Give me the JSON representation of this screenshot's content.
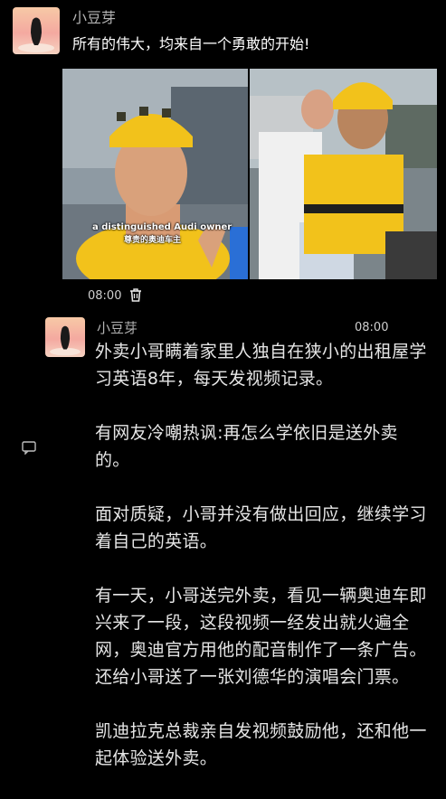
{
  "post1": {
    "username": "小豆芽",
    "caption": "所有的伟大，均来自一个勇敢的开始!",
    "video_subtitle_en": "a distinguished Audi owner",
    "video_subtitle_cn": "尊贵的奥迪车主",
    "time": "08:00",
    "delete_icon": "trash-icon"
  },
  "post2": {
    "username": "小豆芽",
    "time": "08:00",
    "paragraphs": [
      "外卖小哥瞒着家里人独自在狭小的出租屋学习英语8年，每天发视频记录。",
      "有网友冷嘲热讽:再怎么学依旧是送外卖的。",
      "面对质疑，小哥并没有做出回应，继续学习着自己的英语。",
      "有一天，小哥送完外卖，看见一辆奥迪车即兴来了一段，这段视频一经发出就火遍全网，奥迪官方用他的配音制作了一条广告。还给小哥送了一张刘德华的演唱会门票。",
      "凯迪拉克总裁亲自发视频鼓励他，还和他一起体验送外卖。"
    ]
  },
  "side_icon": "comment-icon",
  "colors": {
    "background": "#000000",
    "text": "#e6e6e6",
    "muted": "#b3b3b3",
    "uniform_yellow": "#f2c21b"
  }
}
